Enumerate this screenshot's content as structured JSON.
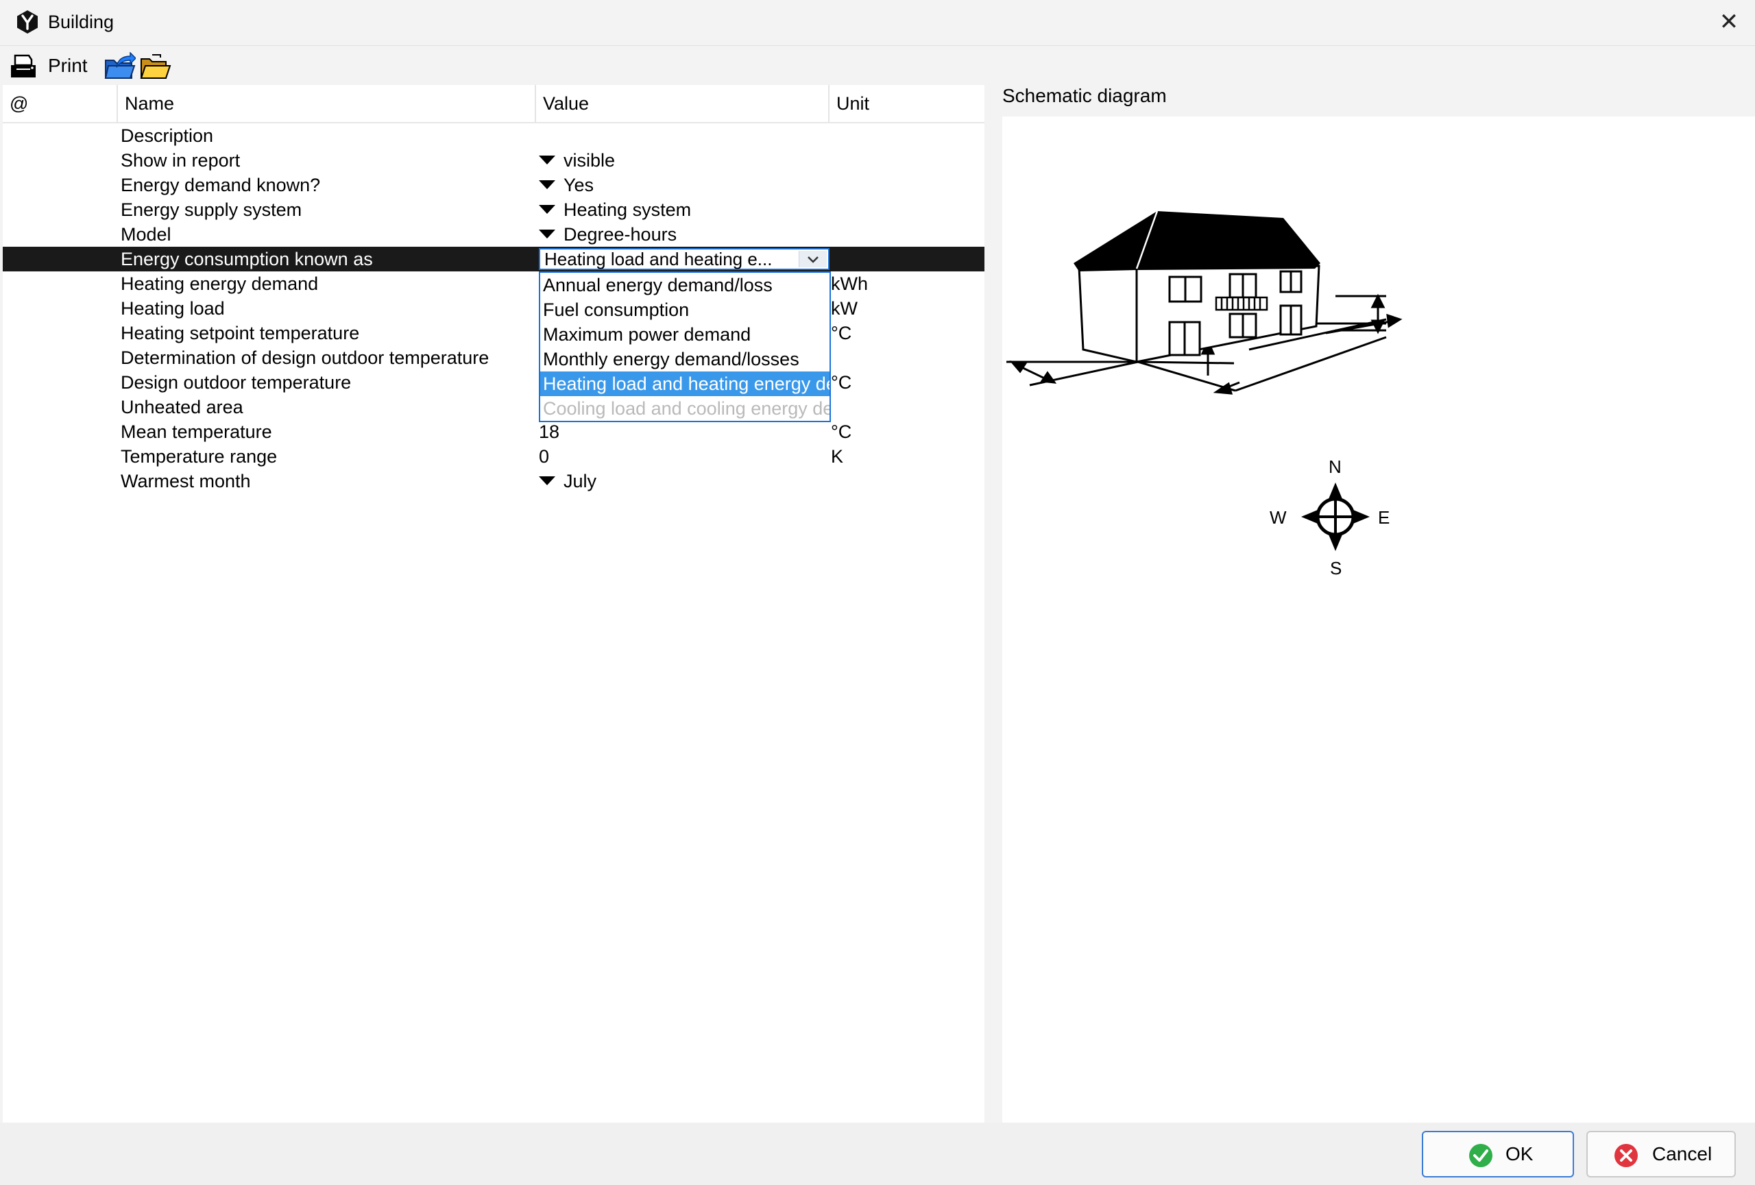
{
  "window": {
    "title": "Building",
    "close_glyph": "✕"
  },
  "toolbar": {
    "print_label": "Print"
  },
  "table": {
    "headers": {
      "at": "@",
      "name": "Name",
      "value": "Value",
      "unit": "Unit"
    },
    "rows": [
      {
        "name": "Description",
        "value": "",
        "unit": "",
        "dropdown": false
      },
      {
        "name": "Show in report",
        "value": "visible",
        "unit": "",
        "dropdown": true
      },
      {
        "name": "Energy demand known?",
        "value": "Yes",
        "unit": "",
        "dropdown": true
      },
      {
        "name": "Energy supply system",
        "value": "Heating system",
        "unit": "",
        "dropdown": true
      },
      {
        "name": "Model",
        "value": "Degree-hours",
        "unit": "",
        "dropdown": true
      },
      {
        "name": "Energy consumption known as",
        "value": "Heating load and heating e...",
        "unit": "",
        "dropdown": true,
        "selected": true
      },
      {
        "name": "Heating energy demand",
        "value": "",
        "unit": "kWh",
        "dropdown": false
      },
      {
        "name": "Heating load",
        "value": "",
        "unit": "kW",
        "dropdown": false
      },
      {
        "name": "Heating setpoint temperature",
        "value": "",
        "unit": "°C",
        "dropdown": false
      },
      {
        "name": "Determination of design outdoor temperature",
        "value": "",
        "unit": "",
        "dropdown": false
      },
      {
        "name": "Design outdoor temperature",
        "value": "",
        "unit": "°C",
        "dropdown": false
      },
      {
        "name": "Unheated area",
        "value": "",
        "unit": "",
        "dropdown": false
      },
      {
        "name": "Mean temperature",
        "value": "18",
        "unit": "°C",
        "dropdown": false
      },
      {
        "name": "Temperature range",
        "value": "0",
        "unit": "K",
        "dropdown": false
      },
      {
        "name": "Warmest month",
        "value": "July",
        "unit": "",
        "dropdown": true
      }
    ]
  },
  "combo": {
    "value": "Heating load and heating e..."
  },
  "dropdown_options": [
    {
      "label": "Annual energy demand/loss",
      "state": "normal"
    },
    {
      "label": "Fuel consumption",
      "state": "normal"
    },
    {
      "label": "Maximum power demand",
      "state": "normal"
    },
    {
      "label": "Monthly energy demand/losses",
      "state": "normal"
    },
    {
      "label": "Heating load and heating energy demand",
      "state": "highlighted"
    },
    {
      "label": "Cooling load and cooling energy demand",
      "state": "disabled"
    }
  ],
  "schematic": {
    "title": "Schematic diagram",
    "compass": {
      "n": "N",
      "e": "E",
      "s": "S",
      "w": "W"
    }
  },
  "buttons": {
    "ok": "OK",
    "cancel": "Cancel"
  },
  "colors": {
    "selection_row": "#1a1a1a",
    "highlight": "#3a98ea",
    "focus_border": "#1a73d9",
    "ok_icon": "#2fae4a",
    "cancel_icon": "#e0343e"
  }
}
